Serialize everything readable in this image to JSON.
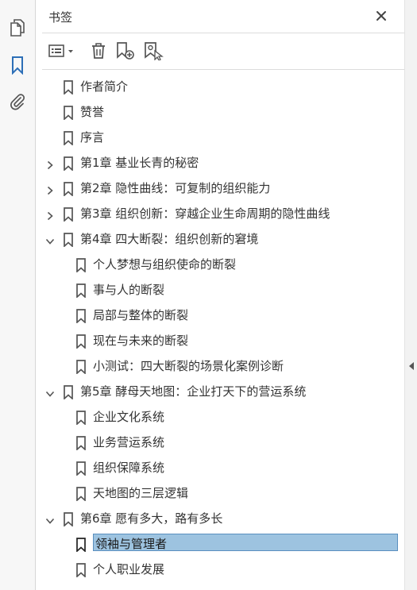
{
  "panel": {
    "title": "书签"
  },
  "rail": {
    "items": [
      "pages-icon",
      "bookmark-icon",
      "attachment-icon"
    ]
  },
  "toolbar": {
    "buttons": [
      "options-menu",
      "delete-bookmark",
      "new-bookmark",
      "new-bookmark-from-structure"
    ]
  },
  "colors": {
    "accent": "#2d6fb7",
    "selection": "#9dc3e0",
    "selection_border": "#5a8fbf"
  },
  "bookmarks": [
    {
      "label": "作者简介",
      "level": 0,
      "twisty": "none",
      "selected": false
    },
    {
      "label": "赞誉",
      "level": 0,
      "twisty": "none",
      "selected": false
    },
    {
      "label": "序言",
      "level": 0,
      "twisty": "none",
      "selected": false
    },
    {
      "label": "第1章 基业长青的秘密",
      "level": 0,
      "twisty": "collapsed",
      "selected": false
    },
    {
      "label": "第2章 隐性曲线：可复制的组织能力",
      "level": 0,
      "twisty": "collapsed",
      "selected": false
    },
    {
      "label": "第3章 组织创新：穿越企业生命周期的隐性曲线",
      "level": 0,
      "twisty": "collapsed",
      "selected": false
    },
    {
      "label": "第4章 四大断裂：组织创新的窘境",
      "level": 0,
      "twisty": "expanded",
      "selected": false
    },
    {
      "label": "个人梦想与组织使命的断裂",
      "level": 1,
      "twisty": "none",
      "selected": false
    },
    {
      "label": "事与人的断裂",
      "level": 1,
      "twisty": "none",
      "selected": false
    },
    {
      "label": "局部与整体的断裂",
      "level": 1,
      "twisty": "none",
      "selected": false
    },
    {
      "label": "现在与未来的断裂",
      "level": 1,
      "twisty": "none",
      "selected": false
    },
    {
      "label": "小测试：四大断裂的场景化案例诊断",
      "level": 1,
      "twisty": "none",
      "selected": false
    },
    {
      "label": "第5章 酵母天地图：企业打天下的营运系统",
      "level": 0,
      "twisty": "expanded",
      "selected": false
    },
    {
      "label": "企业文化系统",
      "level": 1,
      "twisty": "none",
      "selected": false
    },
    {
      "label": "业务营运系统",
      "level": 1,
      "twisty": "none",
      "selected": false
    },
    {
      "label": "组织保障系统",
      "level": 1,
      "twisty": "none",
      "selected": false
    },
    {
      "label": "天地图的三层逻辑",
      "level": 1,
      "twisty": "none",
      "selected": false
    },
    {
      "label": "第6章 愿有多大，路有多长",
      "level": 0,
      "twisty": "expanded",
      "selected": false
    },
    {
      "label": "领袖与管理者",
      "level": 1,
      "twisty": "none",
      "selected": true
    },
    {
      "label": "个人职业发展",
      "level": 1,
      "twisty": "none",
      "selected": false
    }
  ]
}
